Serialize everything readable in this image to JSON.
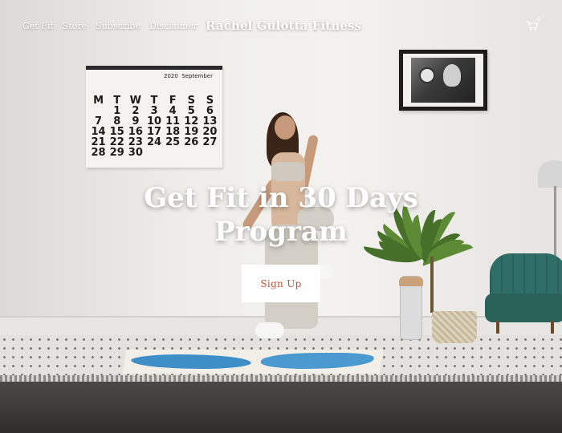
{
  "header": {
    "nav": [
      {
        "label": "Get Fit"
      },
      {
        "label": "Store"
      },
      {
        "label": "Subscribe"
      },
      {
        "label": "Disclaimer"
      }
    ],
    "brand": "Rachel Gulotta Fitness",
    "cart": {
      "icon": "cart-icon",
      "count": "0"
    }
  },
  "hero": {
    "title_line1": "Get Fit in 30 Days",
    "title_line2": "Program",
    "cta_label": "Sign Up",
    "cta_text_color": "#c0553d"
  },
  "background": {
    "calendar": {
      "year": "2020",
      "month": "September",
      "days": [
        "M",
        "T",
        "W",
        "T",
        "F",
        "S",
        "S",
        "",
        "1",
        "2",
        "3",
        "4",
        "5",
        "6",
        "7",
        "8",
        "9",
        "10",
        "11",
        "12",
        "13",
        "14",
        "15",
        "16",
        "17",
        "18",
        "19",
        "20",
        "21",
        "22",
        "23",
        "24",
        "25",
        "26",
        "27",
        "28",
        "29",
        "30",
        "",
        "",
        "",
        ""
      ]
    }
  }
}
